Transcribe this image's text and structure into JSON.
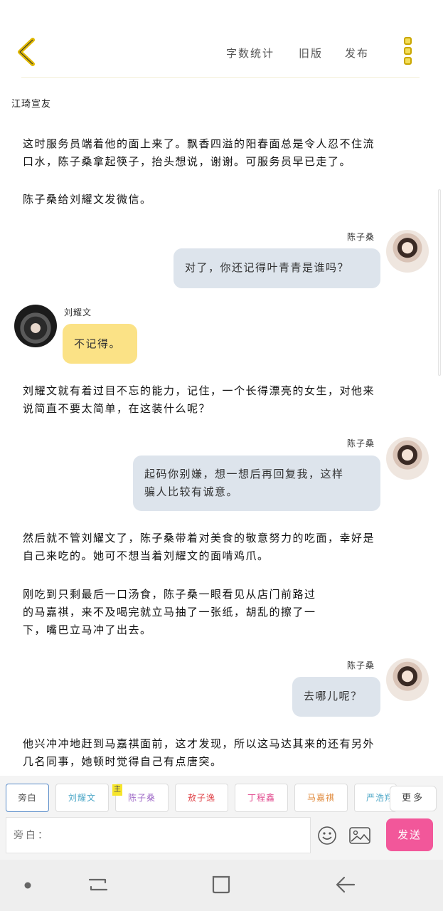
{
  "header": {
    "menu": [
      "字数统计",
      "旧版",
      "发布"
    ]
  },
  "book": {
    "title": "江琦宣友"
  },
  "content": {
    "n1": [
      "这时服务员端着他的面上来了。飘香四溢的阳春面总是令人忍不住流",
      "口水，陈子桑拿起筷子，抬头想说，谢谢。可服务员早已走了。"
    ],
    "n2": [
      "陈子桑给刘耀文发微信。"
    ],
    "m1_speaker": "陈子桑",
    "m1_text": "对了，你还记得叶青青是谁吗？",
    "m2_speaker": "刘耀文",
    "m2_text": "不记得。",
    "n3": [
      "刘耀文就有着过目不忘的能力，记住，一个长得漂亮的女生，对他来",
      "说简直不要太简单，在这装什么呢？"
    ],
    "m3_speaker": "陈子桑",
    "m3_text": [
      "起码你别嫌，想一想后再回复我，这样",
      "骗人比较有诚意。"
    ],
    "n4": [
      "然后就不管刘耀文了，陈子桑带着对美食的敬意努力的吃面，幸好是",
      "自己来吃的。她可不想当着刘耀文的面啃鸡爪。"
    ],
    "n5": [
      "刚吃到只剩最后一口汤食，陈子桑一眼看见从店门前路过",
      "的马嘉祺，来不及喝完就立马抽了一张纸，胡乱的擦了一",
      "下，嘴巴立马冲了出去。"
    ],
    "m4_speaker": "陈子桑",
    "m4_text": "去哪儿呢？",
    "n6": [
      "他兴冲冲地赶到马嘉祺面前，这才发现，所以这马达其来的还有另外",
      "几名同事，她顿时觉得自己有点唐突。"
    ]
  },
  "composer": {
    "chips": [
      {
        "label": "旁白",
        "color": "#555555"
      },
      {
        "label": "刘耀文",
        "color": "#4fa8c8"
      },
      {
        "label": "陈子桑",
        "color": "#a06cc8"
      },
      {
        "label": "敖子逸",
        "color": "#e0464b"
      },
      {
        "label": "丁程鑫",
        "color": "#e0438a"
      },
      {
        "label": "马嘉祺",
        "color": "#e08a3c"
      },
      {
        "label": "严浩翔",
        "color": "#4fa8c8"
      }
    ],
    "main_badge": "主",
    "more": "更多",
    "input_placeholder": "旁白：",
    "send": "发送"
  }
}
